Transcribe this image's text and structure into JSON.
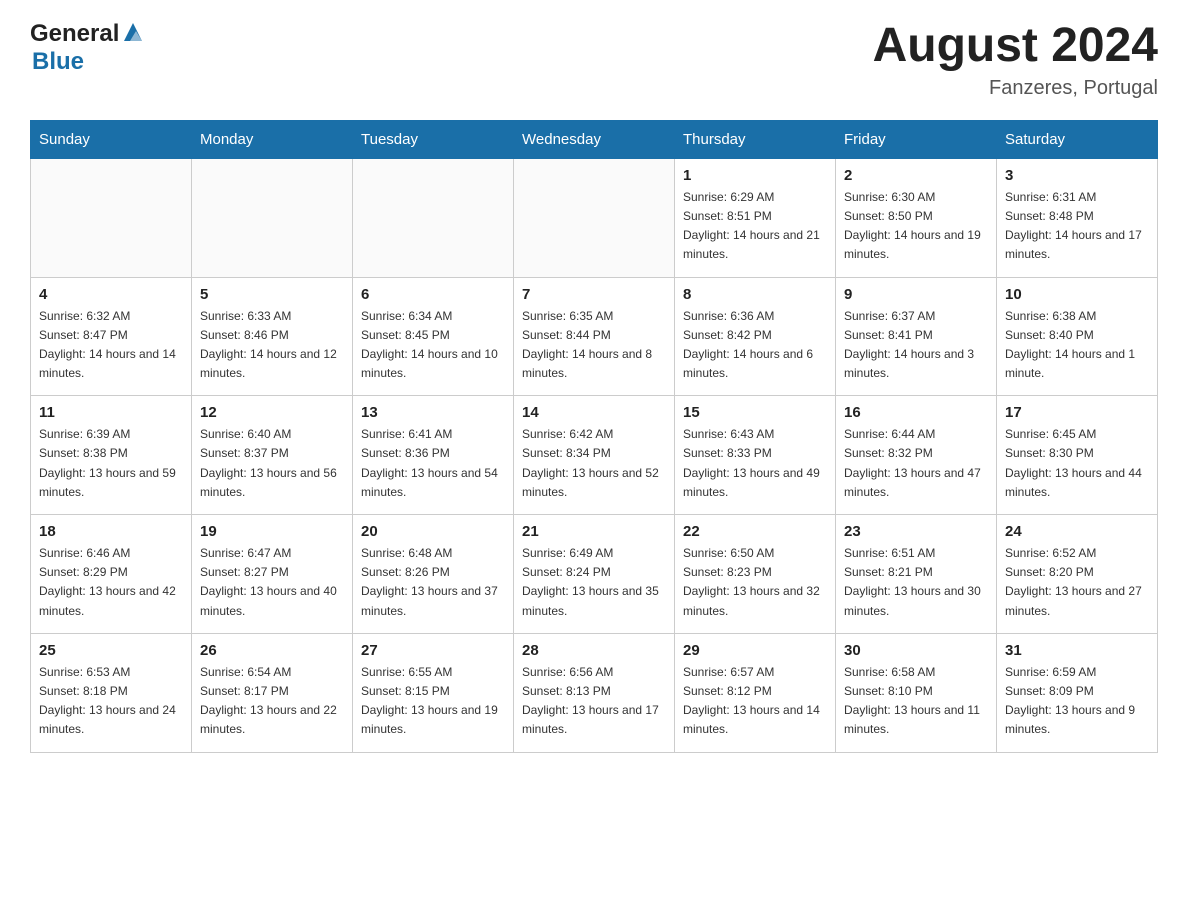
{
  "header": {
    "logo_general": "General",
    "logo_blue": "Blue",
    "month_title": "August 2024",
    "location": "Fanzeres, Portugal"
  },
  "weekdays": [
    "Sunday",
    "Monday",
    "Tuesday",
    "Wednesday",
    "Thursday",
    "Friday",
    "Saturday"
  ],
  "weeks": [
    [
      {
        "day": "",
        "sunrise": "",
        "sunset": "",
        "daylight": ""
      },
      {
        "day": "",
        "sunrise": "",
        "sunset": "",
        "daylight": ""
      },
      {
        "day": "",
        "sunrise": "",
        "sunset": "",
        "daylight": ""
      },
      {
        "day": "",
        "sunrise": "",
        "sunset": "",
        "daylight": ""
      },
      {
        "day": "1",
        "sunrise": "Sunrise: 6:29 AM",
        "sunset": "Sunset: 8:51 PM",
        "daylight": "Daylight: 14 hours and 21 minutes."
      },
      {
        "day": "2",
        "sunrise": "Sunrise: 6:30 AM",
        "sunset": "Sunset: 8:50 PM",
        "daylight": "Daylight: 14 hours and 19 minutes."
      },
      {
        "day": "3",
        "sunrise": "Sunrise: 6:31 AM",
        "sunset": "Sunset: 8:48 PM",
        "daylight": "Daylight: 14 hours and 17 minutes."
      }
    ],
    [
      {
        "day": "4",
        "sunrise": "Sunrise: 6:32 AM",
        "sunset": "Sunset: 8:47 PM",
        "daylight": "Daylight: 14 hours and 14 minutes."
      },
      {
        "day": "5",
        "sunrise": "Sunrise: 6:33 AM",
        "sunset": "Sunset: 8:46 PM",
        "daylight": "Daylight: 14 hours and 12 minutes."
      },
      {
        "day": "6",
        "sunrise": "Sunrise: 6:34 AM",
        "sunset": "Sunset: 8:45 PM",
        "daylight": "Daylight: 14 hours and 10 minutes."
      },
      {
        "day": "7",
        "sunrise": "Sunrise: 6:35 AM",
        "sunset": "Sunset: 8:44 PM",
        "daylight": "Daylight: 14 hours and 8 minutes."
      },
      {
        "day": "8",
        "sunrise": "Sunrise: 6:36 AM",
        "sunset": "Sunset: 8:42 PM",
        "daylight": "Daylight: 14 hours and 6 minutes."
      },
      {
        "day": "9",
        "sunrise": "Sunrise: 6:37 AM",
        "sunset": "Sunset: 8:41 PM",
        "daylight": "Daylight: 14 hours and 3 minutes."
      },
      {
        "day": "10",
        "sunrise": "Sunrise: 6:38 AM",
        "sunset": "Sunset: 8:40 PM",
        "daylight": "Daylight: 14 hours and 1 minute."
      }
    ],
    [
      {
        "day": "11",
        "sunrise": "Sunrise: 6:39 AM",
        "sunset": "Sunset: 8:38 PM",
        "daylight": "Daylight: 13 hours and 59 minutes."
      },
      {
        "day": "12",
        "sunrise": "Sunrise: 6:40 AM",
        "sunset": "Sunset: 8:37 PM",
        "daylight": "Daylight: 13 hours and 56 minutes."
      },
      {
        "day": "13",
        "sunrise": "Sunrise: 6:41 AM",
        "sunset": "Sunset: 8:36 PM",
        "daylight": "Daylight: 13 hours and 54 minutes."
      },
      {
        "day": "14",
        "sunrise": "Sunrise: 6:42 AM",
        "sunset": "Sunset: 8:34 PM",
        "daylight": "Daylight: 13 hours and 52 minutes."
      },
      {
        "day": "15",
        "sunrise": "Sunrise: 6:43 AM",
        "sunset": "Sunset: 8:33 PM",
        "daylight": "Daylight: 13 hours and 49 minutes."
      },
      {
        "day": "16",
        "sunrise": "Sunrise: 6:44 AM",
        "sunset": "Sunset: 8:32 PM",
        "daylight": "Daylight: 13 hours and 47 minutes."
      },
      {
        "day": "17",
        "sunrise": "Sunrise: 6:45 AM",
        "sunset": "Sunset: 8:30 PM",
        "daylight": "Daylight: 13 hours and 44 minutes."
      }
    ],
    [
      {
        "day": "18",
        "sunrise": "Sunrise: 6:46 AM",
        "sunset": "Sunset: 8:29 PM",
        "daylight": "Daylight: 13 hours and 42 minutes."
      },
      {
        "day": "19",
        "sunrise": "Sunrise: 6:47 AM",
        "sunset": "Sunset: 8:27 PM",
        "daylight": "Daylight: 13 hours and 40 minutes."
      },
      {
        "day": "20",
        "sunrise": "Sunrise: 6:48 AM",
        "sunset": "Sunset: 8:26 PM",
        "daylight": "Daylight: 13 hours and 37 minutes."
      },
      {
        "day": "21",
        "sunrise": "Sunrise: 6:49 AM",
        "sunset": "Sunset: 8:24 PM",
        "daylight": "Daylight: 13 hours and 35 minutes."
      },
      {
        "day": "22",
        "sunrise": "Sunrise: 6:50 AM",
        "sunset": "Sunset: 8:23 PM",
        "daylight": "Daylight: 13 hours and 32 minutes."
      },
      {
        "day": "23",
        "sunrise": "Sunrise: 6:51 AM",
        "sunset": "Sunset: 8:21 PM",
        "daylight": "Daylight: 13 hours and 30 minutes."
      },
      {
        "day": "24",
        "sunrise": "Sunrise: 6:52 AM",
        "sunset": "Sunset: 8:20 PM",
        "daylight": "Daylight: 13 hours and 27 minutes."
      }
    ],
    [
      {
        "day": "25",
        "sunrise": "Sunrise: 6:53 AM",
        "sunset": "Sunset: 8:18 PM",
        "daylight": "Daylight: 13 hours and 24 minutes."
      },
      {
        "day": "26",
        "sunrise": "Sunrise: 6:54 AM",
        "sunset": "Sunset: 8:17 PM",
        "daylight": "Daylight: 13 hours and 22 minutes."
      },
      {
        "day": "27",
        "sunrise": "Sunrise: 6:55 AM",
        "sunset": "Sunset: 8:15 PM",
        "daylight": "Daylight: 13 hours and 19 minutes."
      },
      {
        "day": "28",
        "sunrise": "Sunrise: 6:56 AM",
        "sunset": "Sunset: 8:13 PM",
        "daylight": "Daylight: 13 hours and 17 minutes."
      },
      {
        "day": "29",
        "sunrise": "Sunrise: 6:57 AM",
        "sunset": "Sunset: 8:12 PM",
        "daylight": "Daylight: 13 hours and 14 minutes."
      },
      {
        "day": "30",
        "sunrise": "Sunrise: 6:58 AM",
        "sunset": "Sunset: 8:10 PM",
        "daylight": "Daylight: 13 hours and 11 minutes."
      },
      {
        "day": "31",
        "sunrise": "Sunrise: 6:59 AM",
        "sunset": "Sunset: 8:09 PM",
        "daylight": "Daylight: 13 hours and 9 minutes."
      }
    ]
  ]
}
